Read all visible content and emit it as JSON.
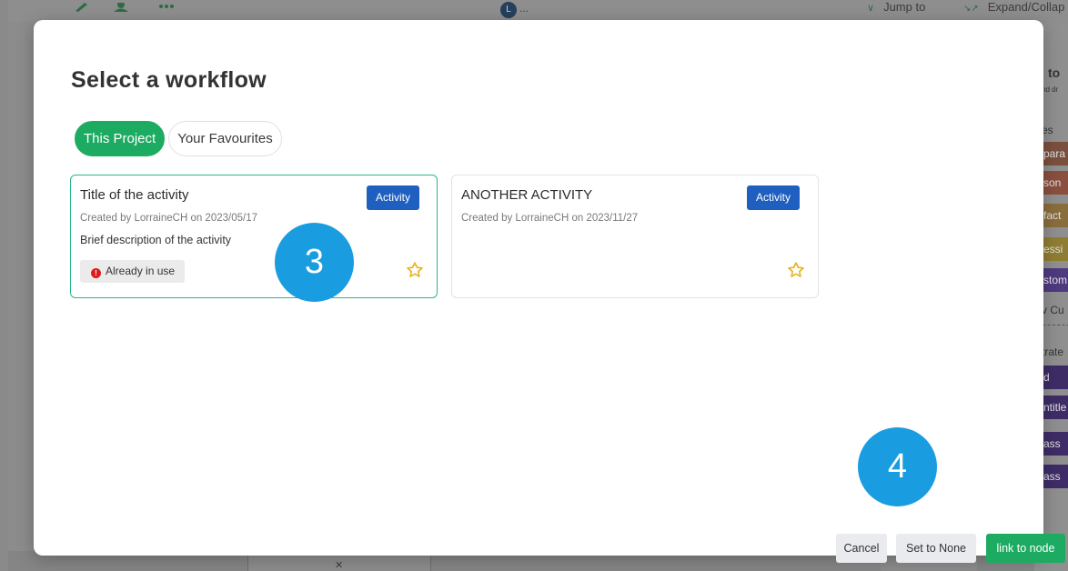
{
  "background": {
    "user_chip": "L",
    "user_more": "...",
    "jump_to": "Jump to",
    "expand_collapse": "Expand/Collap",
    "panel": {
      "title": "to",
      "subtitle": "nd dr",
      "heading": "es",
      "swatches": [
        {
          "label": "para",
          "color": "#7a4f3e"
        },
        {
          "label": "son",
          "color": "#8a4f3e"
        },
        {
          "label": "fact",
          "color": "#8a6d3c"
        },
        {
          "label": "essi",
          "color": "#8f7d33"
        },
        {
          "label": "stom",
          "color": "#4e3a7f"
        }
      ],
      "plain_item": "v Cu",
      "section2": "trate",
      "purple_items": [
        {
          "label": "d",
          "color": "#3e2c67"
        },
        {
          "label": "ntitle",
          "color": "#3e2c67"
        },
        {
          "label": "ass",
          "color": "#3e2c67"
        },
        {
          "label": "ass",
          "color": "#3e2c67"
        }
      ]
    }
  },
  "modal": {
    "title": "Select a workflow",
    "tabs": [
      {
        "label": "This Project",
        "active": true
      },
      {
        "label": "Your Favourites",
        "active": false
      }
    ],
    "cards": [
      {
        "title": "Title of the activity",
        "meta": "Created by LorraineCH on 2023/05/17",
        "description": "Brief description of the activity",
        "badge": "Activity",
        "status": "Already in use",
        "selected": true
      },
      {
        "title": "ANOTHER ACTIVITY",
        "meta": "Created by LorraineCH on 2023/11/27",
        "description": "",
        "badge": "Activity",
        "status": "",
        "selected": false
      }
    ],
    "buttons": {
      "cancel": "Cancel",
      "set_none": "Set to None",
      "link": "link to node"
    }
  },
  "annotations": {
    "step_a": "3",
    "step_b": "4"
  },
  "colors": {
    "primary_green": "#1dab62",
    "badge_blue": "#1f5fbf",
    "step_blue": "#1a9de0",
    "star_gold": "#e8b321",
    "error_red": "#e01b1b"
  }
}
